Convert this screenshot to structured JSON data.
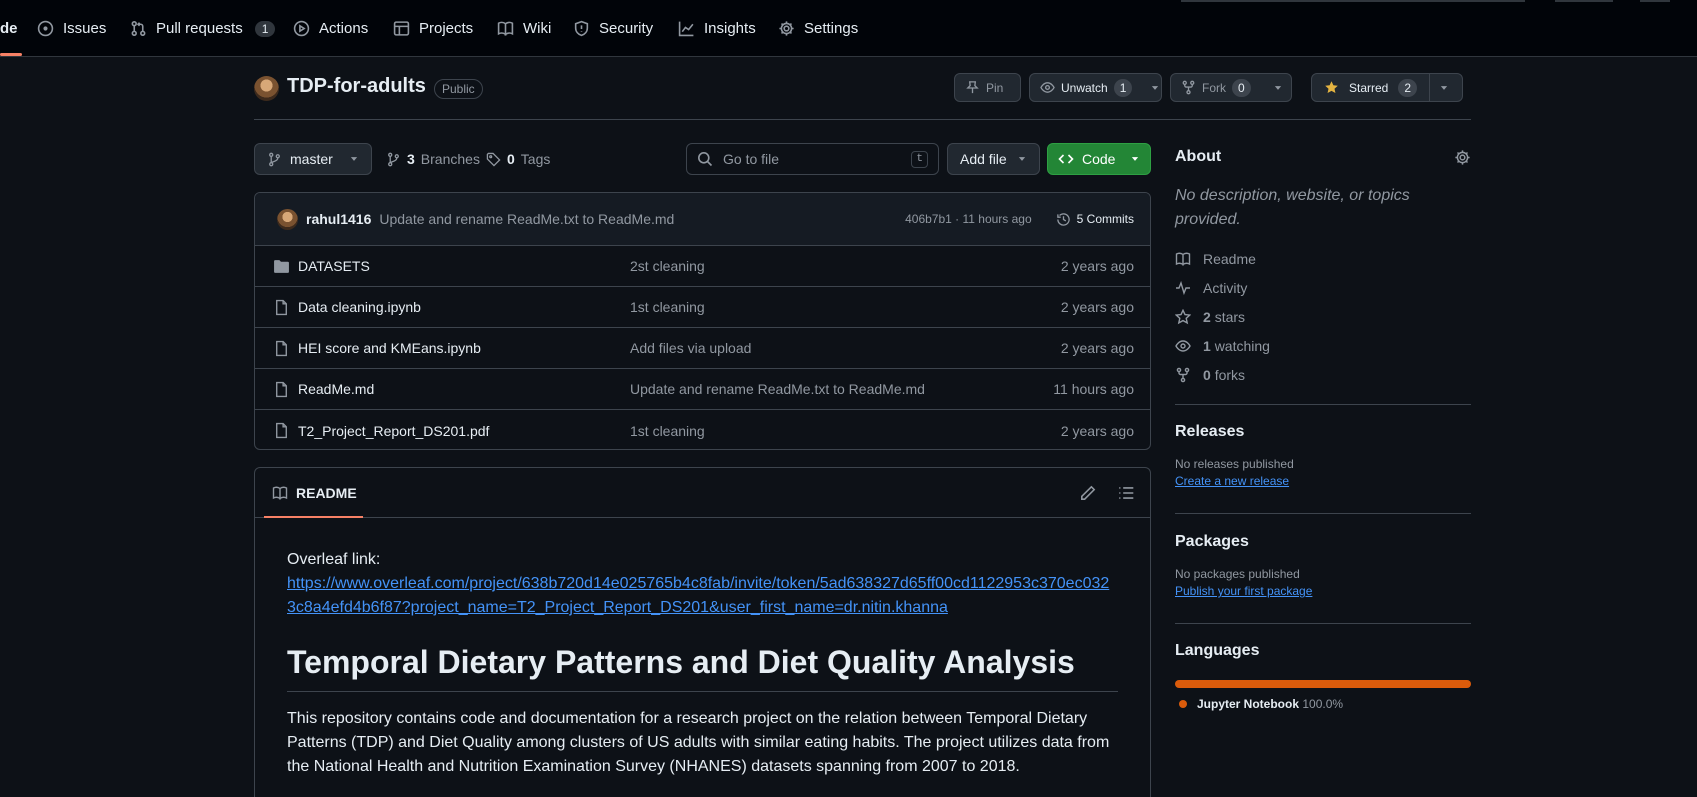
{
  "nav": {
    "code_partial": "de",
    "issues": "Issues",
    "pull_requests": "Pull requests",
    "pull_requests_count": "1",
    "actions": "Actions",
    "projects": "Projects",
    "wiki": "Wiki",
    "security": "Security",
    "insights": "Insights",
    "settings": "Settings"
  },
  "repo": {
    "name": "TDP-for-adults",
    "visibility": "Public",
    "pin_label": "Pin",
    "unwatch_label": "Unwatch",
    "watch_count": "1",
    "fork_label": "Fork",
    "fork_count": "0",
    "starred_label": "Starred",
    "star_count": "2"
  },
  "toolbar": {
    "branch": "master",
    "branches_count": "3",
    "branches_label": "Branches",
    "tags_count": "0",
    "tags_label": "Tags",
    "search_placeholder": "Go to file",
    "search_shortcut": "t",
    "add_file": "Add file",
    "code": "Code"
  },
  "latest_commit": {
    "author": "rahul1416",
    "message": "Update and rename ReadMe.txt to ReadMe.md",
    "meta": "406b7b1 · 11 hours ago",
    "commits": "5 Commits"
  },
  "files": [
    {
      "name": "DATASETS",
      "type": "folder",
      "message": "2st cleaning",
      "age": "2 years ago"
    },
    {
      "name": "Data cleaning.ipynb",
      "type": "file",
      "message": "1st cleaning",
      "age": "2 years ago"
    },
    {
      "name": "HEI score and KMEans.ipynb",
      "type": "file",
      "message": "Add files via upload",
      "age": "2 years ago"
    },
    {
      "name": "ReadMe.md",
      "type": "file",
      "message": "Update and rename ReadMe.txt to ReadMe.md",
      "age": "11 hours ago"
    },
    {
      "name": "T2_Project_Report_DS201.pdf",
      "type": "file",
      "message": "1st cleaning",
      "age": "2 years ago"
    }
  ],
  "readme": {
    "tab": "README",
    "overleaf_label": "Overleaf link:",
    "overleaf_url_line1": "https://www.overleaf.com/project/638b720d14e025765b4c8fab/invite/token/5ad638327d65ff00cd1122953c370ec032",
    "overleaf_url_line2": "3c8a4efd4b6f87?project_name=T2_Project_Report_DS201&user_first_name=dr.nitin.khanna",
    "heading": "Temporal Dietary Patterns and Diet Quality Analysis",
    "paragraph": "This repository contains code and documentation for a research project on the relation between Temporal Dietary Patterns (TDP) and Diet Quality among clusters of US adults with similar eating habits. The project utilizes data from the National Health and Nutrition Examination Survey (NHANES) datasets spanning from 2007 to 2018."
  },
  "about": {
    "title": "About",
    "description": "No description, website, or topics provided.",
    "readme": "Readme",
    "activity": "Activity",
    "stars_count": "2",
    "stars_label": "stars",
    "watching_count": "1",
    "watching_label": "watching",
    "forks_count": "0",
    "forks_label": "forks"
  },
  "releases": {
    "title": "Releases",
    "none": "No releases published",
    "create_link": "Create a new release"
  },
  "packages": {
    "title": "Packages",
    "none": "No packages published",
    "publish_link": "Publish your first package"
  },
  "languages": {
    "title": "Languages",
    "items": [
      {
        "name": "Jupyter Notebook",
        "percent": "100.0%",
        "color": "#da5b0b"
      }
    ]
  },
  "colors": {
    "background": "#0d1117",
    "nav_background": "#010409",
    "border": "#3d444d",
    "link": "#4493f8",
    "code_button": "#238636",
    "accent_underline": "#f78166",
    "star": "#e3b341"
  }
}
